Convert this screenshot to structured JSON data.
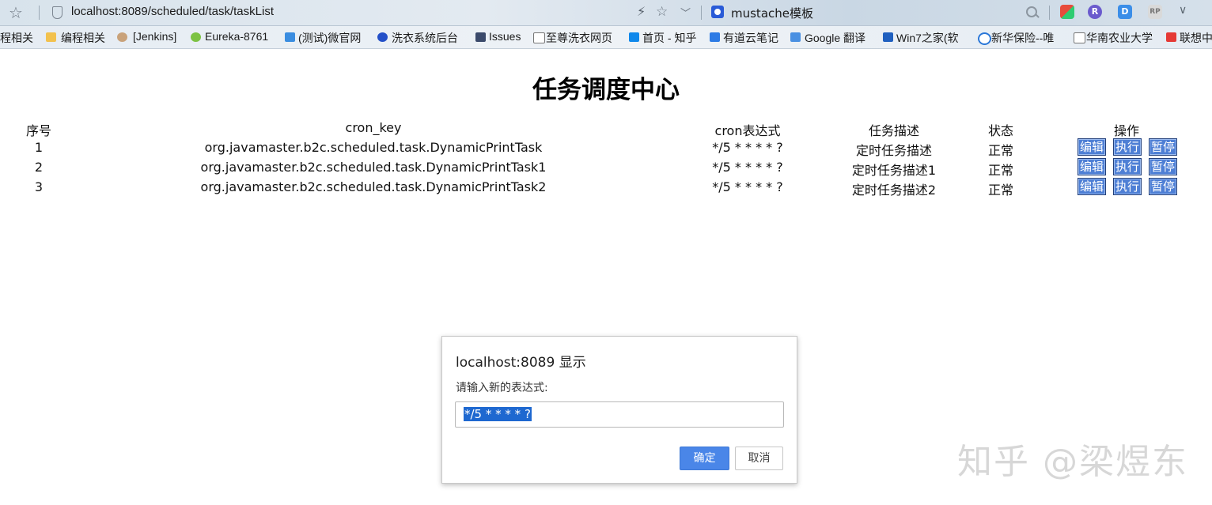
{
  "browser": {
    "url": "localhost:8089/scheduled/task/taskList",
    "extension_title": "mustache模板",
    "ext_r": "R",
    "ext_d": "D",
    "ext_rp": "RP"
  },
  "bookmarks": [
    "程相关",
    "编程相关",
    "[Jenkins]",
    "Eureka-8761",
    "(测试)微官网",
    "洗衣系统后台",
    "Issues",
    "至尊洗衣网页",
    "首页 - 知乎",
    "有道云笔记",
    "Google 翻译",
    "Win7之家(软",
    "新华保险--唯",
    "华南农业大学",
    "联想中"
  ],
  "page": {
    "title": "任务调度中心"
  },
  "table": {
    "headers": {
      "index": "序号",
      "cron_key": "cron_key",
      "cron_expr": "cron表达式",
      "desc": "任务描述",
      "status": "状态",
      "ops": "操作"
    },
    "rows": [
      {
        "index": "1",
        "cron_key": "org.javamaster.b2c.scheduled.task.DynamicPrintTask",
        "cron_expr": "*/5 * * * * ?",
        "desc": "定时任务描述",
        "status": "正常"
      },
      {
        "index": "2",
        "cron_key": "org.javamaster.b2c.scheduled.task.DynamicPrintTask1",
        "cron_expr": "*/5 * * * * ?",
        "desc": "定时任务描述1",
        "status": "正常"
      },
      {
        "index": "3",
        "cron_key": "org.javamaster.b2c.scheduled.task.DynamicPrintTask2",
        "cron_expr": "*/5 * * * * ?",
        "desc": "定时任务描述2",
        "status": "正常"
      }
    ],
    "actions": {
      "edit": "编辑",
      "run": "执行",
      "pause": "暂停"
    }
  },
  "dialog": {
    "title": "localhost:8089 显示",
    "message": "请输入新的表达式:",
    "input_value": "*/5 * * * * ?",
    "ok": "确定",
    "cancel": "取消"
  },
  "watermark": "知乎 @梁煜东",
  "colors": {
    "action_button": "#4e7fd5",
    "ok_button": "#4a86e8",
    "selection": "#1e68d0"
  }
}
